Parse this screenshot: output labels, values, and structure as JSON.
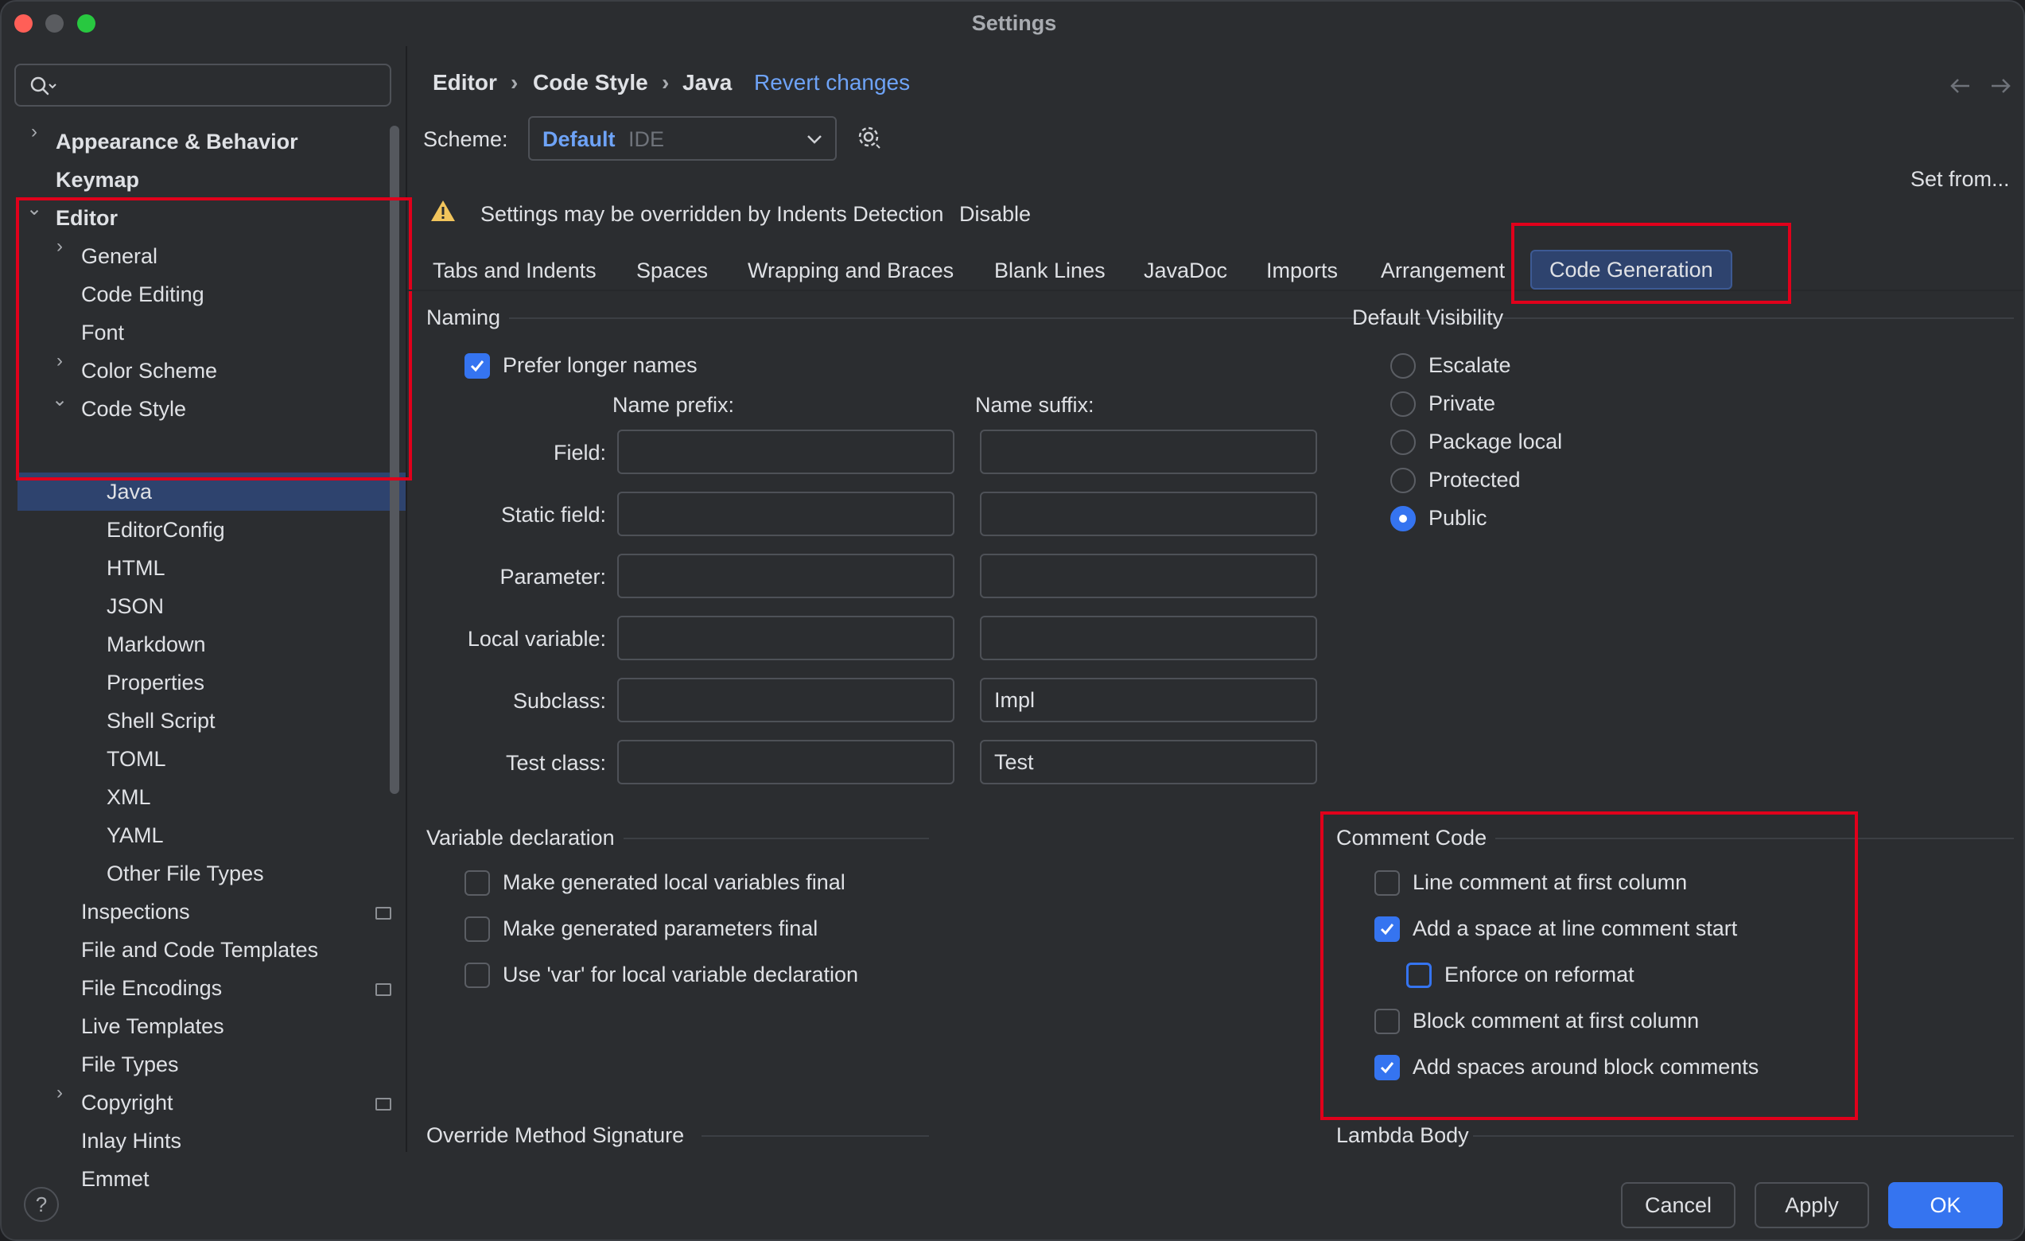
{
  "window": {
    "title": "Settings"
  },
  "search": {
    "placeholder": ""
  },
  "sidebar": {
    "items": [
      {
        "label": "Appearance & Behavior"
      },
      {
        "label": "Keymap"
      },
      {
        "label": "Editor"
      },
      {
        "label": "General"
      },
      {
        "label": "Code Editing"
      },
      {
        "label": "Font"
      },
      {
        "label": "Color Scheme"
      },
      {
        "label": "Code Style"
      },
      {
        "label": "Java"
      },
      {
        "label": "EditorConfig"
      },
      {
        "label": "HTML"
      },
      {
        "label": "JSON"
      },
      {
        "label": "Markdown"
      },
      {
        "label": "Properties"
      },
      {
        "label": "Shell Script"
      },
      {
        "label": "TOML"
      },
      {
        "label": "XML"
      },
      {
        "label": "YAML"
      },
      {
        "label": "Other File Types"
      },
      {
        "label": "Inspections"
      },
      {
        "label": "File and Code Templates"
      },
      {
        "label": "File Encodings"
      },
      {
        "label": "Live Templates"
      },
      {
        "label": "File Types"
      },
      {
        "label": "Copyright"
      },
      {
        "label": "Inlay Hints"
      },
      {
        "label": "Emmet"
      }
    ]
  },
  "breadcrumb": {
    "a": "Editor",
    "b": "Code Style",
    "c": "Java",
    "revert": "Revert changes"
  },
  "scheme": {
    "label": "Scheme:",
    "name": "Default",
    "kind": "IDE"
  },
  "set_from": "Set from...",
  "warning": {
    "text": "Settings may be overridden by Indents Detection",
    "action": "Disable"
  },
  "tabs": [
    "Tabs and Indents",
    "Spaces",
    "Wrapping and Braces",
    "Blank Lines",
    "JavaDoc",
    "Imports",
    "Arrangement",
    "Code Generation"
  ],
  "naming": {
    "title": "Naming",
    "prefer_longer": "Prefer longer names",
    "prefix_header": "Name prefix:",
    "suffix_header": "Name suffix:",
    "rows": [
      {
        "label": "Field:",
        "prefix": "",
        "suffix": ""
      },
      {
        "label": "Static field:",
        "prefix": "",
        "suffix": ""
      },
      {
        "label": "Parameter:",
        "prefix": "",
        "suffix": ""
      },
      {
        "label": "Local variable:",
        "prefix": "",
        "suffix": ""
      },
      {
        "label": "Subclass:",
        "prefix": "",
        "suffix": "Impl"
      },
      {
        "label": "Test class:",
        "prefix": "",
        "suffix": "Test"
      }
    ]
  },
  "visibility": {
    "title": "Default Visibility",
    "options": [
      "Escalate",
      "Private",
      "Package local",
      "Protected",
      "Public"
    ],
    "selected": "Public"
  },
  "variable_decl": {
    "title": "Variable declaration",
    "options": [
      {
        "label": "Make generated local variables final",
        "checked": false
      },
      {
        "label": "Make generated parameters final",
        "checked": false
      },
      {
        "label": "Use 'var' for local variable declaration",
        "checked": false
      }
    ]
  },
  "comment_code": {
    "title": "Comment Code",
    "options": [
      {
        "label": "Line comment at first column",
        "checked": false
      },
      {
        "label": "Add a space at line comment start",
        "checked": true
      },
      {
        "label": "Enforce on reformat",
        "checked": false
      },
      {
        "label": "Block comment at first column",
        "checked": false
      },
      {
        "label": "Add spaces around block comments",
        "checked": true
      }
    ]
  },
  "bottom_sections": {
    "override": "Override Method Signature",
    "lambda": "Lambda Body"
  },
  "buttons": {
    "help": "?",
    "cancel": "Cancel",
    "apply": "Apply",
    "ok": "OK"
  },
  "colors": {
    "accent": "#3574f0",
    "link": "#6ea3f7",
    "highlight": "#e0001b",
    "selection": "#2e436e"
  }
}
